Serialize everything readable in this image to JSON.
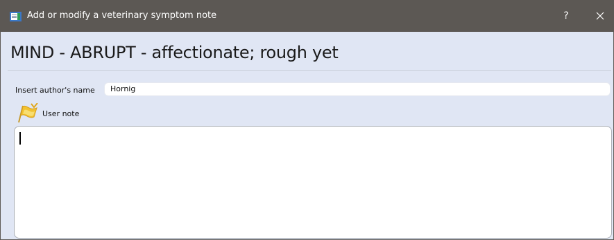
{
  "window": {
    "title": "Add or modify a veterinary symptom note",
    "help_label": "?",
    "icons": {
      "app": "notepad-app-icon",
      "close": "close-icon",
      "note": "flag-icon"
    }
  },
  "symptom": {
    "heading": "MIND - ABRUPT - affectionate; rough yet"
  },
  "author": {
    "label": "Insert author's name",
    "value": "Hornig"
  },
  "note": {
    "label": "User note",
    "value": ""
  },
  "colors": {
    "titlebar": "#5c5854",
    "background": "#e0e6f4",
    "field": "#ffffff"
  }
}
